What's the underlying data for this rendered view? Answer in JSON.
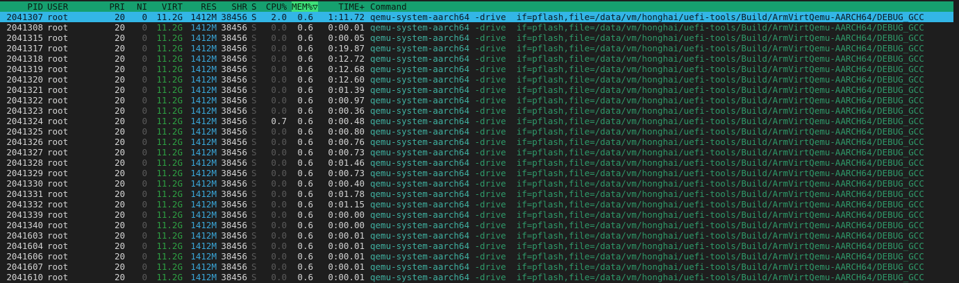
{
  "header": {
    "pid": "PID",
    "user": "USER",
    "pri": "PRI",
    "ni": "NI",
    "virt": "VIRT",
    "res": "RES",
    "shr": "SHR",
    "s": "S",
    "cpu": "CPU%",
    "mem": "MEM%▽",
    "time": "TIME+",
    "command": "Command"
  },
  "colors": {
    "header_bg": "#16a06f",
    "selected_bg": "#33b6e6",
    "background": "#1e1e1e"
  },
  "cmd_prog": "qemu-system-aarch64",
  "cmd_args": " -drive  if=pflash,file=/data/vm/honghai/uefi-tools/Build/ArmVirtQemu-AARCH64/DEBUG_GCC",
  "processes": [
    {
      "pid": "2041307",
      "user": "root",
      "pri": "20",
      "ni": "0",
      "virt": "11.2G",
      "res": "1412M",
      "shr": "38456",
      "s": "S",
      "cpu": "2.0",
      "mem": "0.6",
      "time": "1:11.72",
      "selected": true
    },
    {
      "pid": "2041308",
      "user": "root",
      "pri": "20",
      "ni": "0",
      "virt": "11.2G",
      "res": "1412M",
      "shr": "38456",
      "s": "S",
      "cpu": "0.0",
      "mem": "0.6",
      "time": "0:00.01"
    },
    {
      "pid": "2041315",
      "user": "root",
      "pri": "20",
      "ni": "0",
      "virt": "11.2G",
      "res": "1412M",
      "shr": "38456",
      "s": "S",
      "cpu": "0.0",
      "mem": "0.6",
      "time": "0:00.05"
    },
    {
      "pid": "2041317",
      "user": "root",
      "pri": "20",
      "ni": "0",
      "virt": "11.2G",
      "res": "1412M",
      "shr": "38456",
      "s": "S",
      "cpu": "0.0",
      "mem": "0.6",
      "time": "0:19.87"
    },
    {
      "pid": "2041318",
      "user": "root",
      "pri": "20",
      "ni": "0",
      "virt": "11.2G",
      "res": "1412M",
      "shr": "38456",
      "s": "S",
      "cpu": "0.0",
      "mem": "0.6",
      "time": "0:12.72"
    },
    {
      "pid": "2041319",
      "user": "root",
      "pri": "20",
      "ni": "0",
      "virt": "11.2G",
      "res": "1412M",
      "shr": "38456",
      "s": "S",
      "cpu": "0.0",
      "mem": "0.6",
      "time": "0:12.68"
    },
    {
      "pid": "2041320",
      "user": "root",
      "pri": "20",
      "ni": "0",
      "virt": "11.2G",
      "res": "1412M",
      "shr": "38456",
      "s": "S",
      "cpu": "0.0",
      "mem": "0.6",
      "time": "0:12.60"
    },
    {
      "pid": "2041321",
      "user": "root",
      "pri": "20",
      "ni": "0",
      "virt": "11.2G",
      "res": "1412M",
      "shr": "38456",
      "s": "S",
      "cpu": "0.0",
      "mem": "0.6",
      "time": "0:01.39"
    },
    {
      "pid": "2041322",
      "user": "root",
      "pri": "20",
      "ni": "0",
      "virt": "11.2G",
      "res": "1412M",
      "shr": "38456",
      "s": "S",
      "cpu": "0.0",
      "mem": "0.6",
      "time": "0:00.97"
    },
    {
      "pid": "2041323",
      "user": "root",
      "pri": "20",
      "ni": "0",
      "virt": "11.2G",
      "res": "1412M",
      "shr": "38456",
      "s": "S",
      "cpu": "0.0",
      "mem": "0.6",
      "time": "0:00.36"
    },
    {
      "pid": "2041324",
      "user": "root",
      "pri": "20",
      "ni": "0",
      "virt": "11.2G",
      "res": "1412M",
      "shr": "38456",
      "s": "S",
      "cpu": "0.7",
      "mem": "0.6",
      "time": "0:00.48"
    },
    {
      "pid": "2041325",
      "user": "root",
      "pri": "20",
      "ni": "0",
      "virt": "11.2G",
      "res": "1412M",
      "shr": "38456",
      "s": "S",
      "cpu": "0.0",
      "mem": "0.6",
      "time": "0:00.80"
    },
    {
      "pid": "2041326",
      "user": "root",
      "pri": "20",
      "ni": "0",
      "virt": "11.2G",
      "res": "1412M",
      "shr": "38456",
      "s": "S",
      "cpu": "0.0",
      "mem": "0.6",
      "time": "0:00.76"
    },
    {
      "pid": "2041327",
      "user": "root",
      "pri": "20",
      "ni": "0",
      "virt": "11.2G",
      "res": "1412M",
      "shr": "38456",
      "s": "S",
      "cpu": "0.0",
      "mem": "0.6",
      "time": "0:00.73"
    },
    {
      "pid": "2041328",
      "user": "root",
      "pri": "20",
      "ni": "0",
      "virt": "11.2G",
      "res": "1412M",
      "shr": "38456",
      "s": "S",
      "cpu": "0.0",
      "mem": "0.6",
      "time": "0:01.46"
    },
    {
      "pid": "2041329",
      "user": "root",
      "pri": "20",
      "ni": "0",
      "virt": "11.2G",
      "res": "1412M",
      "shr": "38456",
      "s": "S",
      "cpu": "0.0",
      "mem": "0.6",
      "time": "0:00.73"
    },
    {
      "pid": "2041330",
      "user": "root",
      "pri": "20",
      "ni": "0",
      "virt": "11.2G",
      "res": "1412M",
      "shr": "38456",
      "s": "S",
      "cpu": "0.0",
      "mem": "0.6",
      "time": "0:00.40"
    },
    {
      "pid": "2041331",
      "user": "root",
      "pri": "20",
      "ni": "0",
      "virt": "11.2G",
      "res": "1412M",
      "shr": "38456",
      "s": "S",
      "cpu": "0.0",
      "mem": "0.6",
      "time": "0:01.78"
    },
    {
      "pid": "2041332",
      "user": "root",
      "pri": "20",
      "ni": "0",
      "virt": "11.2G",
      "res": "1412M",
      "shr": "38456",
      "s": "S",
      "cpu": "0.0",
      "mem": "0.6",
      "time": "0:01.15"
    },
    {
      "pid": "2041339",
      "user": "root",
      "pri": "20",
      "ni": "0",
      "virt": "11.2G",
      "res": "1412M",
      "shr": "38456",
      "s": "S",
      "cpu": "0.0",
      "mem": "0.6",
      "time": "0:00.00"
    },
    {
      "pid": "2041340",
      "user": "root",
      "pri": "20",
      "ni": "0",
      "virt": "11.2G",
      "res": "1412M",
      "shr": "38456",
      "s": "S",
      "cpu": "0.0",
      "mem": "0.6",
      "time": "0:00.00"
    },
    {
      "pid": "2041603",
      "user": "root",
      "pri": "20",
      "ni": "0",
      "virt": "11.2G",
      "res": "1412M",
      "shr": "38456",
      "s": "S",
      "cpu": "0.0",
      "mem": "0.6",
      "time": "0:00.01"
    },
    {
      "pid": "2041604",
      "user": "root",
      "pri": "20",
      "ni": "0",
      "virt": "11.2G",
      "res": "1412M",
      "shr": "38456",
      "s": "S",
      "cpu": "0.0",
      "mem": "0.6",
      "time": "0:00.01"
    },
    {
      "pid": "2041606",
      "user": "root",
      "pri": "20",
      "ni": "0",
      "virt": "11.2G",
      "res": "1412M",
      "shr": "38456",
      "s": "S",
      "cpu": "0.0",
      "mem": "0.6",
      "time": "0:00.01"
    },
    {
      "pid": "2041607",
      "user": "root",
      "pri": "20",
      "ni": "0",
      "virt": "11.2G",
      "res": "1412M",
      "shr": "38456",
      "s": "S",
      "cpu": "0.0",
      "mem": "0.6",
      "time": "0:00.01"
    },
    {
      "pid": "2041610",
      "user": "root",
      "pri": "20",
      "ni": "0",
      "virt": "11.2G",
      "res": "1412M",
      "shr": "38456",
      "s": "S",
      "cpu": "0.0",
      "mem": "0.6",
      "time": "0:00.01"
    }
  ]
}
